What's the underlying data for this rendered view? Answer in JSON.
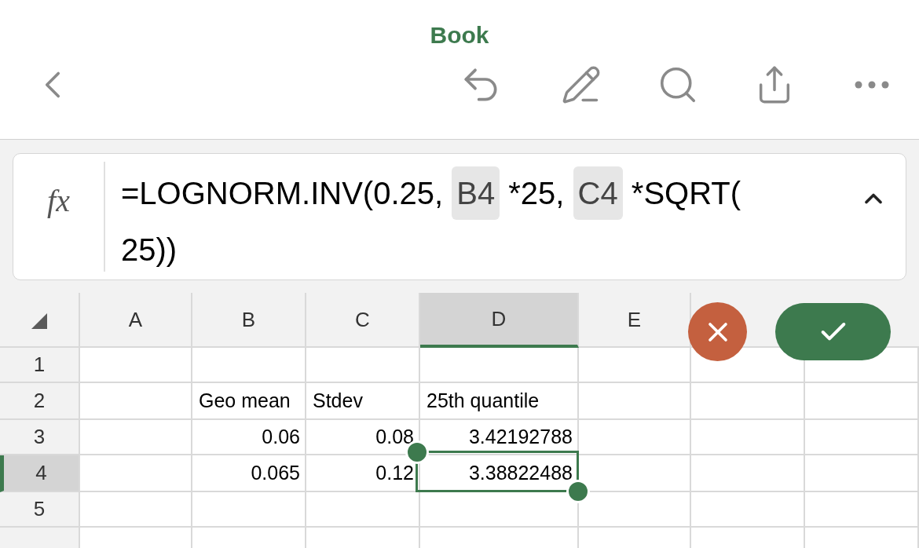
{
  "title": "Book",
  "formula_bar": {
    "label": "fx",
    "expanded": true,
    "lines": [
      [
        {
          "kind": "text",
          "text": "=LOGNORM.INV(0.25, "
        },
        {
          "kind": "ref",
          "text": "B4"
        },
        {
          "kind": "text",
          "text": " *25, "
        },
        {
          "kind": "ref",
          "text": "C4"
        },
        {
          "kind": "text",
          "text": " *SQRT("
        }
      ],
      [
        {
          "kind": "text",
          "text": "25))"
        }
      ]
    ]
  },
  "columns": [
    {
      "label": "A",
      "selected": false
    },
    {
      "label": "B",
      "selected": false
    },
    {
      "label": "C",
      "selected": false
    },
    {
      "label": "D",
      "selected": true
    },
    {
      "label": "E",
      "selected": false
    },
    {
      "selected": false
    },
    {
      "selected": false
    }
  ],
  "rows": [
    {
      "label": "1",
      "selected": false,
      "cells": [
        null,
        null,
        null,
        null,
        null,
        null,
        null
      ]
    },
    {
      "label": "2",
      "selected": false,
      "cells": [
        null,
        {
          "text": "Geo mean",
          "kind": "text"
        },
        {
          "text": "Stdev",
          "kind": "text"
        },
        {
          "text": "25th quantile",
          "kind": "text"
        },
        null,
        null,
        null
      ]
    },
    {
      "label": "3",
      "selected": false,
      "cells": [
        null,
        {
          "text": "0.06",
          "kind": "number"
        },
        {
          "text": "0.08",
          "kind": "number"
        },
        {
          "text": "3.42192788",
          "kind": "number"
        },
        null,
        null,
        null
      ]
    },
    {
      "label": "4",
      "selected": true,
      "cells": [
        null,
        {
          "text": "0.065",
          "kind": "number"
        },
        {
          "text": "0.12",
          "kind": "number"
        },
        {
          "text": "3.38822488",
          "kind": "number",
          "selected": true
        },
        null,
        null,
        null
      ]
    },
    {
      "label": "5",
      "selected": false,
      "cells": [
        null,
        null,
        null,
        null,
        null,
        null,
        null
      ]
    },
    {
      "selected": false,
      "cells": [
        null,
        null,
        null,
        null,
        null,
        null,
        null
      ]
    }
  ]
}
